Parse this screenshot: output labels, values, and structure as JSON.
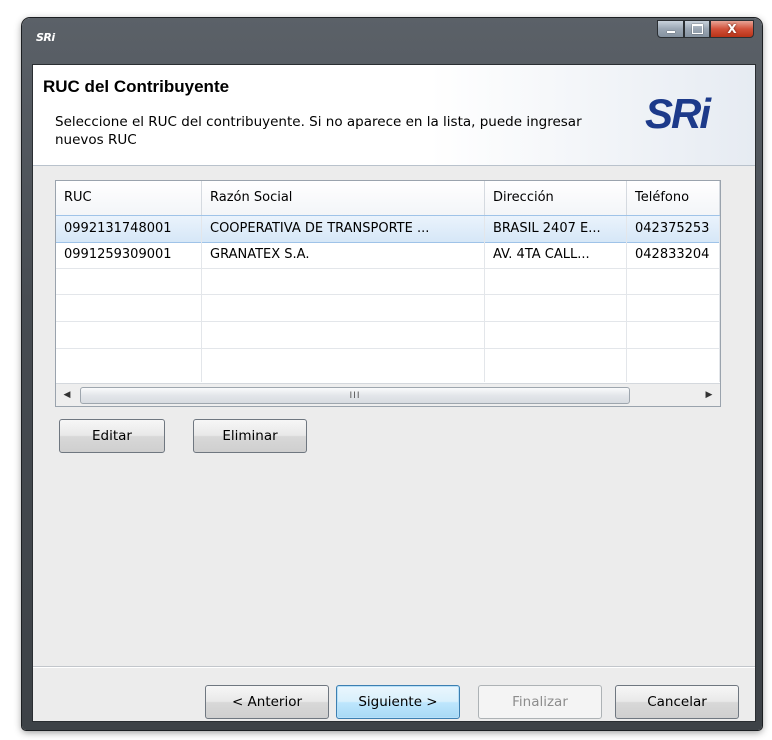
{
  "window": {
    "title_logo": "SRi",
    "controls": {
      "minimize_icon": "minimize-icon",
      "maximize_icon": "maximize-icon",
      "close_icon": "close-icon"
    },
    "close_glyph": "X"
  },
  "header": {
    "title": "RUC del Contribuyente",
    "description": "Seleccione el RUC del contribuyente. Si no aparece en la lista, puede ingresar nuevos RUC",
    "logo": "SRi"
  },
  "table": {
    "columns": [
      "RUC",
      "Razón Social",
      "Dirección",
      "Teléfono"
    ],
    "rows": [
      {
        "ruc": "0992131748001",
        "razon_social": "COOPERATIVA DE TRANSPORTE ...",
        "direccion": "BRASIL 2407 E...",
        "telefono": "042375253"
      },
      {
        "ruc": "0991259309001",
        "razon_social": "GRANATEX S.A.",
        "direccion": "AV. 4TA CALL...",
        "telefono": "042833204"
      }
    ],
    "selected_row": 0,
    "scroll_thumb_glyph": "III"
  },
  "actions": {
    "edit_label": "Editar",
    "delete_label": "Eliminar"
  },
  "wizard": {
    "back_label": "< Anterior",
    "next_label": "Siguiente >",
    "finish_label": "Finalizar",
    "cancel_label": "Cancelar"
  },
  "colors": {
    "brand_blue": "#1d3a8a",
    "brand_red": "#d4231b",
    "selection": "#d6e7f7"
  }
}
